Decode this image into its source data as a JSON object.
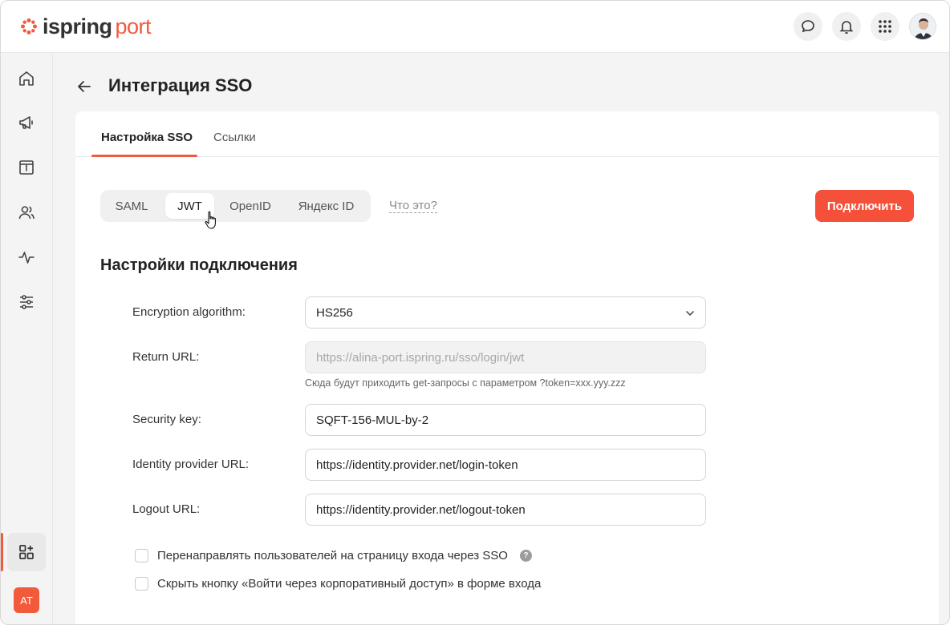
{
  "app": {
    "logo_name": "ispring",
    "logo_port": "port",
    "brand_color": "#f15a3b"
  },
  "topbar": {
    "icons": [
      "chat-icon",
      "bell-icon",
      "apps-grid-icon",
      "user-avatar"
    ]
  },
  "sidebar": {
    "items": [
      "home-icon",
      "megaphone-icon",
      "info-calendar-icon",
      "users-icon",
      "activity-icon",
      "settings-sliders-icon",
      "add-widgets-icon"
    ],
    "user_initials": "AT"
  },
  "page": {
    "title": "Интеграция SSO"
  },
  "tabs": [
    {
      "label": "Настройка SSO",
      "active": true
    },
    {
      "label": "Ссылки",
      "active": false
    }
  ],
  "protocols": {
    "options": [
      "SAML",
      "JWT",
      "OpenID",
      "Яндекс ID"
    ],
    "selected": "JWT",
    "help_link": "Что это?"
  },
  "connect_button": "Подключить",
  "section_title": "Настройки подключения",
  "fields": {
    "encryption": {
      "label": "Encryption algorithm:",
      "value": "HS256"
    },
    "return_url": {
      "label": "Return URL:",
      "placeholder": "https://alina-port.ispring.ru/sso/login/jwt",
      "hint": "Сюда будут приходить get-запросы с параметром ?token=xxx.yyy.zzz"
    },
    "security_key": {
      "label": "Security key:",
      "value": "SQFT-156-MUL-by-2"
    },
    "identity_url": {
      "label": "Identity provider URL:",
      "value": "https://identity.provider.net/login-token"
    },
    "logout_url": {
      "label": "Logout URL:",
      "value": "https://identity.provider.net/logout-token"
    }
  },
  "checkboxes": [
    {
      "label": "Перенаправлять пользователей на страницу входа через SSO",
      "checked": false
    },
    {
      "label": "Скрыть кнопку «Войти через корпоративный доступ» в форме входа",
      "checked": false
    }
  ]
}
